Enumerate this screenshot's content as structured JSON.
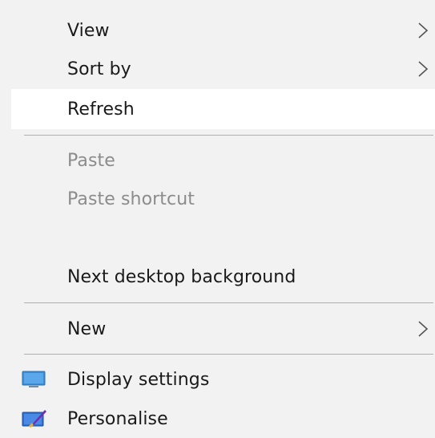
{
  "context_menu": {
    "items": [
      {
        "label": "View",
        "has_submenu": true,
        "disabled": false
      },
      {
        "label": "Sort by",
        "has_submenu": true,
        "disabled": false
      },
      {
        "label": "Refresh",
        "has_submenu": false,
        "disabled": false,
        "highlighted": true
      },
      {
        "label": "Paste",
        "has_submenu": false,
        "disabled": true
      },
      {
        "label": "Paste shortcut",
        "has_submenu": false,
        "disabled": true
      },
      {
        "label": "Next desktop background",
        "has_submenu": false,
        "disabled": false
      },
      {
        "label": "New",
        "has_submenu": true,
        "disabled": false
      },
      {
        "label": "Display settings",
        "icon": "display-settings-icon",
        "disabled": false
      },
      {
        "label": "Personalise",
        "icon": "personalise-icon",
        "disabled": false
      }
    ]
  },
  "colors": {
    "menu_background": "#f2f2f2",
    "highlight_background": "#ffffff",
    "text": "#1a1a1a",
    "disabled_text": "#8c8c8c",
    "separator": "#b0b0b0",
    "icon_blue": "#3b8fd9"
  }
}
